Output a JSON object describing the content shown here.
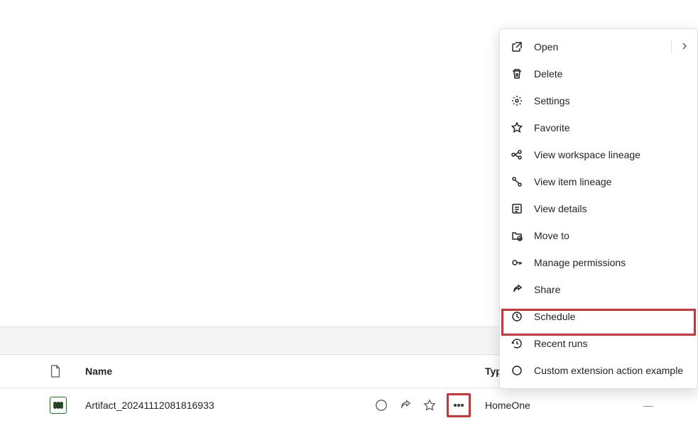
{
  "table": {
    "columns": {
      "name": "Name",
      "type": "Type"
    },
    "row": {
      "name": "Artifact_20241112081816933",
      "type": "HomeOne",
      "owner": "—"
    }
  },
  "menu": {
    "items": [
      {
        "icon": "open-icon",
        "label": "Open",
        "submenu": true
      },
      {
        "icon": "delete-icon",
        "label": "Delete"
      },
      {
        "icon": "settings-icon",
        "label": "Settings"
      },
      {
        "icon": "favorite-icon",
        "label": "Favorite"
      },
      {
        "icon": "lineage-icon",
        "label": "View workspace lineage"
      },
      {
        "icon": "item-lineage-icon",
        "label": "View item lineage"
      },
      {
        "icon": "details-icon",
        "label": "View details"
      },
      {
        "icon": "move-icon",
        "label": "Move to"
      },
      {
        "icon": "permissions-icon",
        "label": "Manage permissions"
      },
      {
        "icon": "share-icon",
        "label": "Share"
      },
      {
        "icon": "schedule-icon",
        "label": "Schedule",
        "highlighted": true
      },
      {
        "icon": "recent-icon",
        "label": "Recent runs"
      },
      {
        "icon": "custom-icon",
        "label": "Custom extension action example"
      }
    ]
  }
}
